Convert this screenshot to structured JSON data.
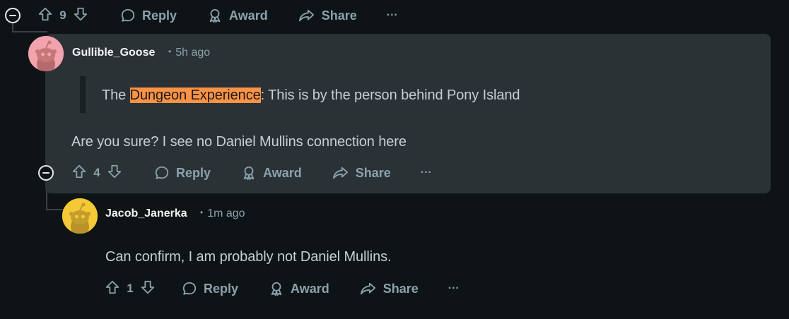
{
  "top_actions": {
    "votes": "9",
    "reply": "Reply",
    "award": "Award",
    "share": "Share",
    "more": "···"
  },
  "comment1": {
    "username": "Gullible_Goose",
    "timestamp": "5h ago",
    "quote_before": "The ",
    "quote_highlight": "Dungeon Experience",
    "quote_after": ": This is by the person behind Pony Island",
    "body": "Are you sure? I see no Daniel Mullins connection here",
    "votes": "4",
    "reply": "Reply",
    "award": "Award",
    "share": "Share",
    "more": "···",
    "avatar_color": "#f2a3ad"
  },
  "comment2": {
    "username": "Jacob_Janerka",
    "timestamp": "1m ago",
    "body": "Can confirm, I am probably not Daniel Mullins.",
    "votes": "1",
    "reply": "Reply",
    "award": "Award",
    "share": "Share",
    "more": "···",
    "avatar_color": "#f5c935"
  },
  "colors": {
    "background": "#0e1416",
    "highlight_card": "#2a3236",
    "highlight_text": "#ff9345",
    "muted": "#8ba2ad"
  },
  "icons": [
    "collapse-icon",
    "upvote-icon",
    "downvote-icon",
    "comment-icon",
    "award-icon",
    "share-icon",
    "more-icon",
    "snoo-avatar-icon"
  ]
}
